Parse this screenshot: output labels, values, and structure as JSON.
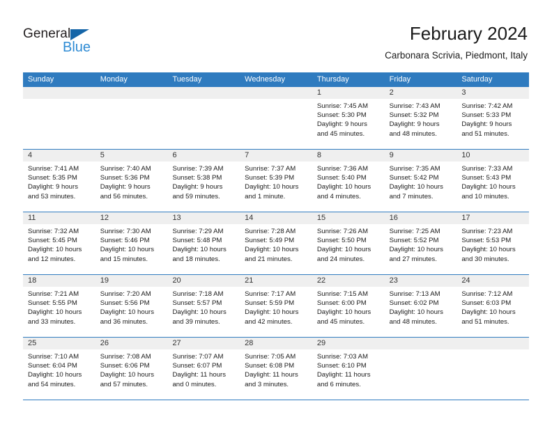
{
  "logo": {
    "name_top": "General",
    "name_bottom": "Blue",
    "triangle_icon": "blue-triangle-icon",
    "color_dark": "#231f20",
    "color_blue": "#2e8bd4",
    "color_triangle": "#1565a8"
  },
  "header": {
    "title": "February 2024",
    "subtitle": "Carbonara Scrivia, Piedmont, Italy"
  },
  "colors": {
    "header_bar": "#2f7bbf",
    "row_divider": "#2f7bbf",
    "day_band": "#efefef",
    "text": "#1a1a1a"
  },
  "weekdays": [
    "Sunday",
    "Monday",
    "Tuesday",
    "Wednesday",
    "Thursday",
    "Friday",
    "Saturday"
  ],
  "weeks": [
    [
      {
        "day": "",
        "empty": true,
        "sunrise": "",
        "sunset": "",
        "daylight_1": "",
        "daylight_2": ""
      },
      {
        "day": "",
        "empty": true,
        "sunrise": "",
        "sunset": "",
        "daylight_1": "",
        "daylight_2": ""
      },
      {
        "day": "",
        "empty": true,
        "sunrise": "",
        "sunset": "",
        "daylight_1": "",
        "daylight_2": ""
      },
      {
        "day": "",
        "empty": true,
        "sunrise": "",
        "sunset": "",
        "daylight_1": "",
        "daylight_2": ""
      },
      {
        "day": "1",
        "empty": false,
        "sunrise": "Sunrise: 7:45 AM",
        "sunset": "Sunset: 5:30 PM",
        "daylight_1": "Daylight: 9 hours",
        "daylight_2": "and 45 minutes."
      },
      {
        "day": "2",
        "empty": false,
        "sunrise": "Sunrise: 7:43 AM",
        "sunset": "Sunset: 5:32 PM",
        "daylight_1": "Daylight: 9 hours",
        "daylight_2": "and 48 minutes."
      },
      {
        "day": "3",
        "empty": false,
        "sunrise": "Sunrise: 7:42 AM",
        "sunset": "Sunset: 5:33 PM",
        "daylight_1": "Daylight: 9 hours",
        "daylight_2": "and 51 minutes."
      }
    ],
    [
      {
        "day": "4",
        "empty": false,
        "sunrise": "Sunrise: 7:41 AM",
        "sunset": "Sunset: 5:35 PM",
        "daylight_1": "Daylight: 9 hours",
        "daylight_2": "and 53 minutes."
      },
      {
        "day": "5",
        "empty": false,
        "sunrise": "Sunrise: 7:40 AM",
        "sunset": "Sunset: 5:36 PM",
        "daylight_1": "Daylight: 9 hours",
        "daylight_2": "and 56 minutes."
      },
      {
        "day": "6",
        "empty": false,
        "sunrise": "Sunrise: 7:39 AM",
        "sunset": "Sunset: 5:38 PM",
        "daylight_1": "Daylight: 9 hours",
        "daylight_2": "and 59 minutes."
      },
      {
        "day": "7",
        "empty": false,
        "sunrise": "Sunrise: 7:37 AM",
        "sunset": "Sunset: 5:39 PM",
        "daylight_1": "Daylight: 10 hours",
        "daylight_2": "and 1 minute."
      },
      {
        "day": "8",
        "empty": false,
        "sunrise": "Sunrise: 7:36 AM",
        "sunset": "Sunset: 5:40 PM",
        "daylight_1": "Daylight: 10 hours",
        "daylight_2": "and 4 minutes."
      },
      {
        "day": "9",
        "empty": false,
        "sunrise": "Sunrise: 7:35 AM",
        "sunset": "Sunset: 5:42 PM",
        "daylight_1": "Daylight: 10 hours",
        "daylight_2": "and 7 minutes."
      },
      {
        "day": "10",
        "empty": false,
        "sunrise": "Sunrise: 7:33 AM",
        "sunset": "Sunset: 5:43 PM",
        "daylight_1": "Daylight: 10 hours",
        "daylight_2": "and 10 minutes."
      }
    ],
    [
      {
        "day": "11",
        "empty": false,
        "sunrise": "Sunrise: 7:32 AM",
        "sunset": "Sunset: 5:45 PM",
        "daylight_1": "Daylight: 10 hours",
        "daylight_2": "and 12 minutes."
      },
      {
        "day": "12",
        "empty": false,
        "sunrise": "Sunrise: 7:30 AM",
        "sunset": "Sunset: 5:46 PM",
        "daylight_1": "Daylight: 10 hours",
        "daylight_2": "and 15 minutes."
      },
      {
        "day": "13",
        "empty": false,
        "sunrise": "Sunrise: 7:29 AM",
        "sunset": "Sunset: 5:48 PM",
        "daylight_1": "Daylight: 10 hours",
        "daylight_2": "and 18 minutes."
      },
      {
        "day": "14",
        "empty": false,
        "sunrise": "Sunrise: 7:28 AM",
        "sunset": "Sunset: 5:49 PM",
        "daylight_1": "Daylight: 10 hours",
        "daylight_2": "and 21 minutes."
      },
      {
        "day": "15",
        "empty": false,
        "sunrise": "Sunrise: 7:26 AM",
        "sunset": "Sunset: 5:50 PM",
        "daylight_1": "Daylight: 10 hours",
        "daylight_2": "and 24 minutes."
      },
      {
        "day": "16",
        "empty": false,
        "sunrise": "Sunrise: 7:25 AM",
        "sunset": "Sunset: 5:52 PM",
        "daylight_1": "Daylight: 10 hours",
        "daylight_2": "and 27 minutes."
      },
      {
        "day": "17",
        "empty": false,
        "sunrise": "Sunrise: 7:23 AM",
        "sunset": "Sunset: 5:53 PM",
        "daylight_1": "Daylight: 10 hours",
        "daylight_2": "and 30 minutes."
      }
    ],
    [
      {
        "day": "18",
        "empty": false,
        "sunrise": "Sunrise: 7:21 AM",
        "sunset": "Sunset: 5:55 PM",
        "daylight_1": "Daylight: 10 hours",
        "daylight_2": "and 33 minutes."
      },
      {
        "day": "19",
        "empty": false,
        "sunrise": "Sunrise: 7:20 AM",
        "sunset": "Sunset: 5:56 PM",
        "daylight_1": "Daylight: 10 hours",
        "daylight_2": "and 36 minutes."
      },
      {
        "day": "20",
        "empty": false,
        "sunrise": "Sunrise: 7:18 AM",
        "sunset": "Sunset: 5:57 PM",
        "daylight_1": "Daylight: 10 hours",
        "daylight_2": "and 39 minutes."
      },
      {
        "day": "21",
        "empty": false,
        "sunrise": "Sunrise: 7:17 AM",
        "sunset": "Sunset: 5:59 PM",
        "daylight_1": "Daylight: 10 hours",
        "daylight_2": "and 42 minutes."
      },
      {
        "day": "22",
        "empty": false,
        "sunrise": "Sunrise: 7:15 AM",
        "sunset": "Sunset: 6:00 PM",
        "daylight_1": "Daylight: 10 hours",
        "daylight_2": "and 45 minutes."
      },
      {
        "day": "23",
        "empty": false,
        "sunrise": "Sunrise: 7:13 AM",
        "sunset": "Sunset: 6:02 PM",
        "daylight_1": "Daylight: 10 hours",
        "daylight_2": "and 48 minutes."
      },
      {
        "day": "24",
        "empty": false,
        "sunrise": "Sunrise: 7:12 AM",
        "sunset": "Sunset: 6:03 PM",
        "daylight_1": "Daylight: 10 hours",
        "daylight_2": "and 51 minutes."
      }
    ],
    [
      {
        "day": "25",
        "empty": false,
        "sunrise": "Sunrise: 7:10 AM",
        "sunset": "Sunset: 6:04 PM",
        "daylight_1": "Daylight: 10 hours",
        "daylight_2": "and 54 minutes."
      },
      {
        "day": "26",
        "empty": false,
        "sunrise": "Sunrise: 7:08 AM",
        "sunset": "Sunset: 6:06 PM",
        "daylight_1": "Daylight: 10 hours",
        "daylight_2": "and 57 minutes."
      },
      {
        "day": "27",
        "empty": false,
        "sunrise": "Sunrise: 7:07 AM",
        "sunset": "Sunset: 6:07 PM",
        "daylight_1": "Daylight: 11 hours",
        "daylight_2": "and 0 minutes."
      },
      {
        "day": "28",
        "empty": false,
        "sunrise": "Sunrise: 7:05 AM",
        "sunset": "Sunset: 6:08 PM",
        "daylight_1": "Daylight: 11 hours",
        "daylight_2": "and 3 minutes."
      },
      {
        "day": "29",
        "empty": false,
        "sunrise": "Sunrise: 7:03 AM",
        "sunset": "Sunset: 6:10 PM",
        "daylight_1": "Daylight: 11 hours",
        "daylight_2": "and 6 minutes."
      },
      {
        "day": "",
        "empty": true,
        "sunrise": "",
        "sunset": "",
        "daylight_1": "",
        "daylight_2": ""
      },
      {
        "day": "",
        "empty": true,
        "sunrise": "",
        "sunset": "",
        "daylight_1": "",
        "daylight_2": ""
      }
    ]
  ]
}
